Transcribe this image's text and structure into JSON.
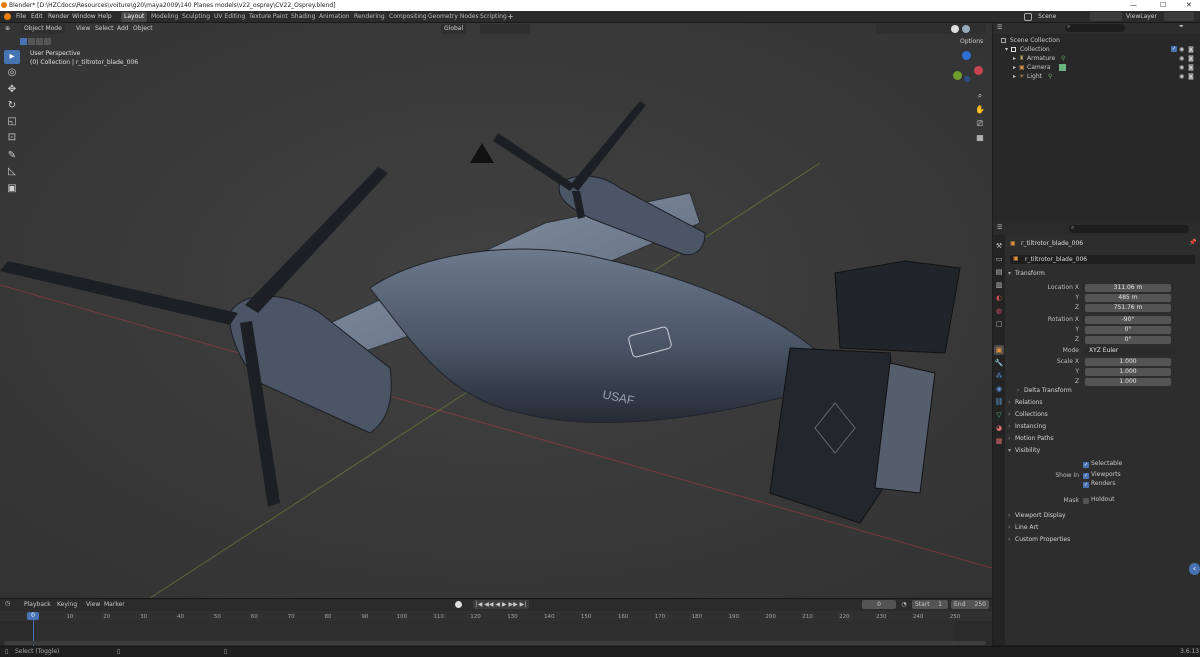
{
  "titlebar": {
    "title": "Blender* [D:\\HZCdocs\\Resources\\voiture\\g20\\maya2009\\140 Planes models\\v22_osprey\\CV22_Osprey.blend]",
    "minimize": "—",
    "maximize": "☐",
    "close": "✕"
  },
  "menu": [
    "File",
    "Edit",
    "Render",
    "Window",
    "Help"
  ],
  "workspaces": [
    "Layout",
    "Modeling",
    "Sculpting",
    "UV Editing",
    "Texture Paint",
    "Shading",
    "Animation",
    "Rendering",
    "Compositing",
    "Geometry Nodes",
    "Scripting"
  ],
  "scene": {
    "label": "Scene",
    "viewlayer": "ViewLayer"
  },
  "viewport": {
    "mode": "Object Mode",
    "menus": [
      "View",
      "Select",
      "Add",
      "Object"
    ],
    "orientation": "Global",
    "options": "Options",
    "perspective": "User Perspective",
    "collection_info": "(0) Collection | r_tiltrotor_blade_006",
    "tools": [
      "Select",
      "Cursor",
      "Move",
      "Rotate",
      "Scale",
      "Transform",
      "Annotate",
      "Measure",
      "Add Cube"
    ]
  },
  "outliner": {
    "search_placeholder": "",
    "rows": [
      {
        "label": "Scene Collection",
        "icon": "scene-collection-icon"
      },
      {
        "label": "Collection",
        "icon": "collection-icon"
      },
      {
        "label": "Armature",
        "icon": "armature-icon"
      },
      {
        "label": "Camera",
        "icon": "camera-icon"
      },
      {
        "label": "Light",
        "icon": "light-icon"
      }
    ]
  },
  "properties": {
    "object_name": "r_tiltrotor_blade_006",
    "data_name": "r_tiltrotor_blade_006",
    "transform_label": "Transform",
    "location": {
      "label": "Location X",
      "x": "311.06 m",
      "y": "485 m",
      "z": "751.76 m"
    },
    "rotation": {
      "label": "Rotation X",
      "x": "-90°",
      "y": "0°",
      "z": "0°"
    },
    "mode_label": "Mode",
    "mode_value": "XYZ Euler",
    "scale": {
      "label": "Scale X",
      "x": "1.000",
      "y": "1.000",
      "z": "1.000"
    },
    "axis_y": "Y",
    "axis_z": "Z",
    "sections": [
      "Delta Transform",
      "Relations",
      "Collections",
      "Instancing",
      "Motion Paths",
      "Visibility"
    ],
    "visibility": {
      "selectable": "Selectable",
      "show_in": "Show In",
      "viewports": "Viewports",
      "renders": "Renders",
      "mask": "Mask",
      "holdout": "Holdout"
    },
    "sections_bottom": [
      "Viewport Display",
      "Line Art",
      "Custom Properties"
    ]
  },
  "timeline": {
    "menus": [
      "Playback",
      "Keying",
      "View",
      "Marker"
    ],
    "current_frame": "0",
    "start_label": "Start",
    "start": "1",
    "end_label": "End",
    "end": "250",
    "ticks": [
      "0",
      "10",
      "20",
      "30",
      "40",
      "50",
      "60",
      "70",
      "80",
      "90",
      "100",
      "110",
      "120",
      "130",
      "140",
      "150",
      "160",
      "170",
      "180",
      "190",
      "200",
      "210",
      "220",
      "230",
      "240",
      "250"
    ]
  },
  "statusbar": {
    "hint": "Select (Toggle)",
    "version": "3.6.13"
  },
  "colors": {
    "accent": "#4772b3",
    "x_axis": "#c8434f",
    "y_axis": "#6f9f2b",
    "z_axis": "#2e6fd6"
  }
}
